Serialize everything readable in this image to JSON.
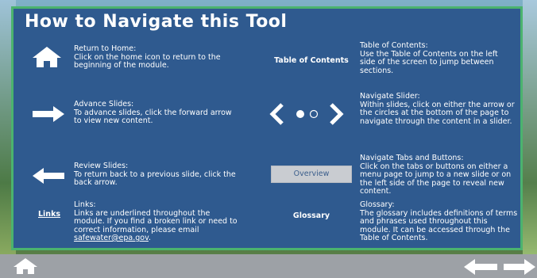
{
  "panel": {
    "title": "How to Navigate this Tool",
    "home": {
      "heading": "Return to Home:",
      "text": "Click on the home icon to return to the beginning of the module."
    },
    "toc": {
      "label": "Table of Contents",
      "heading": "Table of Contents:",
      "text": "Use the Table of Contents on the left side of the screen to jump between sections."
    },
    "advance": {
      "heading": "Advance Slides:",
      "text": "To advance slides, click the forward arrow to view new content."
    },
    "slider": {
      "heading": "Navigate Slider:",
      "text": "Within slides, click on either the arrow or the circles at the bottom of the page to navigate through the content in a slider."
    },
    "review": {
      "heading": "Review Slides:",
      "text": "To return back to a previous slide, click the back arrow."
    },
    "tabs": {
      "button_label": "Overview",
      "heading": "Navigate Tabs and Buttons:",
      "text": "Click on the tabs or buttons on either a menu page to jump to a new slide or on the left side of the page to reveal new content."
    },
    "links": {
      "label": "Links",
      "heading": "Links:",
      "text": "Links are underlined throughout the module. If you find a broken link or need to correct information, please email",
      "email": "safewater@epa.gov",
      "email_suffix": "."
    },
    "glossary": {
      "label": "Glossary",
      "heading": "Glossary:",
      "text": "The glossary includes definitions of terms and phrases used throughout this module. It can be accessed through the Table of Contents."
    }
  },
  "icons": {
    "home": "home-icon",
    "forward": "arrow-right-icon",
    "back": "arrow-left-icon",
    "slider_prev": "chevron-left-icon",
    "slider_next": "chevron-right-icon"
  },
  "colors": {
    "panel_bg": "#2f5a8f",
    "panel_border": "#4bb36e",
    "bottom_bar": "#9da1a6"
  }
}
